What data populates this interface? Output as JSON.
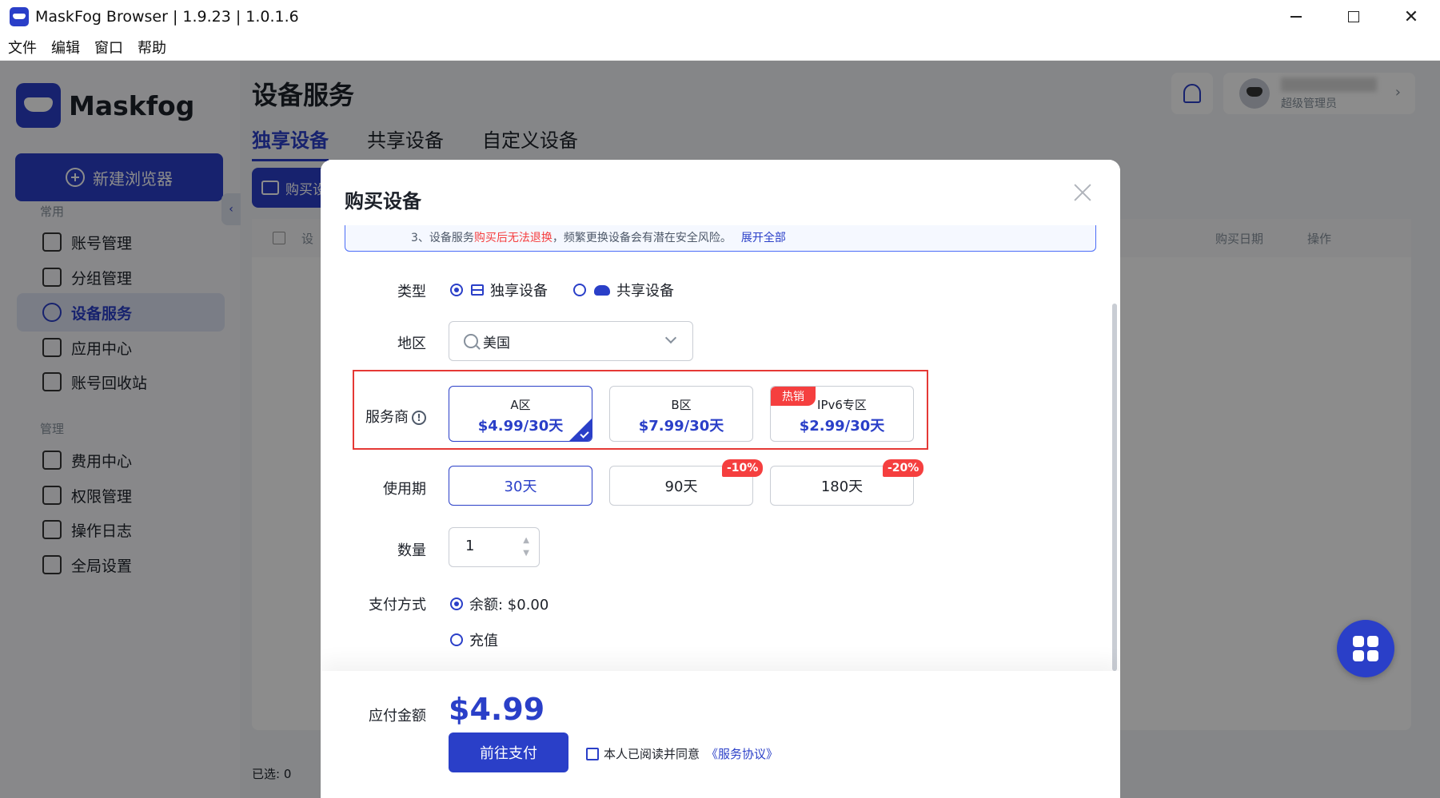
{
  "window": {
    "title": "MaskFog Browser | 1.9.23 | 1.0.1.6",
    "menu": [
      "文件",
      "编辑",
      "窗口",
      "帮助"
    ]
  },
  "sidebar": {
    "logo_text": "Maskfog",
    "new_browser_label": "新建浏览器",
    "section_common": "常用",
    "section_manage": "管理",
    "common_items": [
      {
        "label": "账号管理",
        "icon": "account-icon"
      },
      {
        "label": "分组管理",
        "icon": "folder-icon"
      },
      {
        "label": "设备服务",
        "icon": "location-pin-icon",
        "active": true
      },
      {
        "label": "应用中心",
        "icon": "cube-icon"
      },
      {
        "label": "账号回收站",
        "icon": "trash-icon"
      }
    ],
    "manage_items": [
      {
        "label": "费用中心",
        "icon": "receipt-icon"
      },
      {
        "label": "权限管理",
        "icon": "shield-icon"
      },
      {
        "label": "操作日志",
        "icon": "clipboard-icon"
      },
      {
        "label": "全局设置",
        "icon": "settings-icon"
      }
    ]
  },
  "header": {
    "page_title": "设备服务",
    "tabs": [
      "独享设备",
      "共享设备",
      "自定义设备"
    ],
    "active_tab": "独享设备",
    "buy_button": "购买设",
    "user_role": "超级管理员"
  },
  "table": {
    "col_device": "设",
    "col_date": "购买日期",
    "col_ops": "操作",
    "selected": "已选: 0"
  },
  "modal": {
    "title": "购买设备",
    "notice": {
      "prefix": "3、设备服务",
      "warning": "购买后无法退换",
      "suffix": "，频繁更换设备会有潜在安全风险。",
      "expand": "展开全部"
    },
    "labels": {
      "type": "类型",
      "region": "地区",
      "provider": "服务商",
      "period": "使用期",
      "quantity": "数量",
      "payment": "支付方式",
      "amount": "应付金额"
    },
    "type_options": [
      {
        "label": "独享设备",
        "checked": true
      },
      {
        "label": "共享设备",
        "checked": false
      }
    ],
    "region_value": "美国",
    "providers": [
      {
        "name": "A区",
        "price": "$4.99/30天",
        "selected": true
      },
      {
        "name": "B区",
        "price": "$7.99/30天",
        "selected": false
      },
      {
        "name": "IPv6专区",
        "price": "$2.99/30天",
        "selected": false,
        "badge": "热销"
      }
    ],
    "periods": [
      {
        "label": "30天",
        "selected": true
      },
      {
        "label": "90天",
        "discount": "-10%"
      },
      {
        "label": "180天",
        "discount": "-20%"
      }
    ],
    "quantity": "1",
    "payment_options": [
      {
        "label": "余额: $0.00",
        "checked": true
      },
      {
        "label": "充值",
        "checked": false
      }
    ],
    "amount": "$4.99",
    "pay_button": "前往支付",
    "agree_text": "本人已阅读并同意",
    "agree_link": "《服务协议》"
  },
  "colors": {
    "primary": "#2a3fc8",
    "danger": "#f53f3f"
  }
}
